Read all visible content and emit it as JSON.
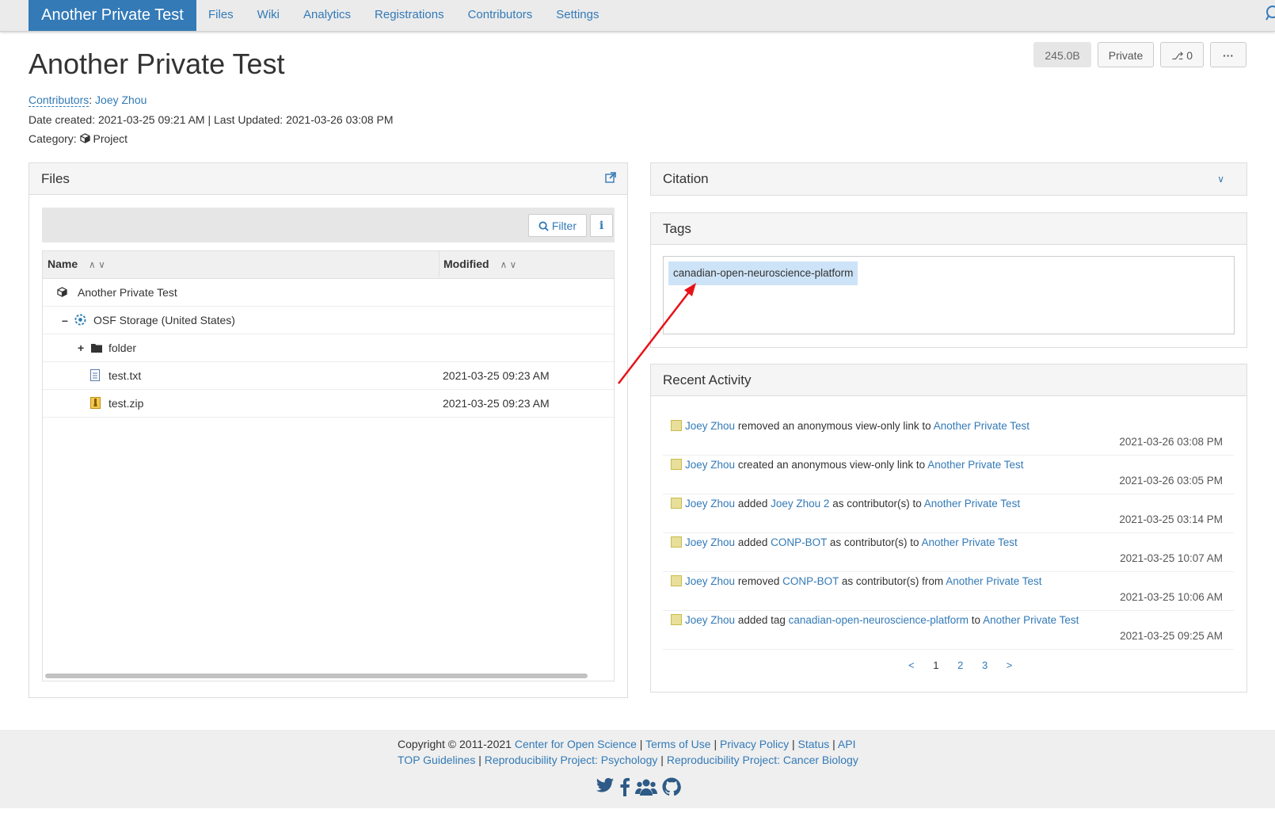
{
  "nav": {
    "brand": "Another Private Test",
    "links": [
      "Files",
      "Wiki",
      "Analytics",
      "Registrations",
      "Contributors",
      "Settings"
    ]
  },
  "header": {
    "title": "Another Private Test",
    "size": "245.0B",
    "privacy": "Private",
    "forks_count": "0",
    "more": "···",
    "contributors_label": "Contributors",
    "contributor": "Joey Zhou",
    "dates": "Date created: 2021-03-25 09:21 AM | Last Updated: 2021-03-26 03:08 PM",
    "category_label": "Category:",
    "category": "Project"
  },
  "files": {
    "title": "Files",
    "filter_label": "Filter",
    "info_label": "i",
    "col_name": "Name",
    "col_modified": "Modified",
    "rows": [
      {
        "name": "Another Private Test",
        "modified": ""
      },
      {
        "name": "OSF Storage (United States)",
        "modified": ""
      },
      {
        "name": "folder",
        "modified": ""
      },
      {
        "name": "test.txt",
        "modified": "2021-03-25 09:23 AM"
      },
      {
        "name": "test.zip",
        "modified": "2021-03-25 09:23 AM"
      }
    ]
  },
  "citation": {
    "title": "Citation"
  },
  "tags": {
    "title": "Tags",
    "items": [
      "canadian-open-neuroscience-platform"
    ]
  },
  "activity": {
    "title": "Recent Activity",
    "items": [
      {
        "user": "Joey Zhou",
        "action": "removed an anonymous view-only link to",
        "obj": "",
        "mid": "",
        "target": "Another Private Test",
        "time": "2021-03-26 03:08 PM"
      },
      {
        "user": "Joey Zhou",
        "action": "created an anonymous view-only link to",
        "obj": "",
        "mid": "",
        "target": "Another Private Test",
        "time": "2021-03-26 03:05 PM"
      },
      {
        "user": "Joey Zhou",
        "action": "added",
        "obj": "Joey Zhou 2",
        "mid": "as contributor(s) to",
        "target": "Another Private Test",
        "time": "2021-03-25 03:14 PM"
      },
      {
        "user": "Joey Zhou",
        "action": "added",
        "obj": "CONP-BOT",
        "mid": "as contributor(s) to",
        "target": "Another Private Test",
        "time": "2021-03-25 10:07 AM"
      },
      {
        "user": "Joey Zhou",
        "action": "removed",
        "obj": "CONP-BOT",
        "mid": "as contributor(s) from",
        "target": "Another Private Test",
        "time": "2021-03-25 10:06 AM"
      },
      {
        "user": "Joey Zhou",
        "action": "added tag",
        "obj": "canadian-open-neuroscience-platform",
        "mid": "to",
        "target": "Another Private Test",
        "time": "2021-03-25 09:25 AM"
      }
    ],
    "pager": [
      "<",
      "1",
      "2",
      "3",
      ">"
    ]
  },
  "footer": {
    "copyright": "Copyright © 2011-2021",
    "links1": [
      "Center for Open Science",
      "Terms of Use",
      "Privacy Policy",
      "Status",
      "API"
    ],
    "links2": [
      "TOP Guidelines",
      "Reproducibility Project: Psychology",
      "Reproducibility Project: Cancer Biology"
    ]
  }
}
